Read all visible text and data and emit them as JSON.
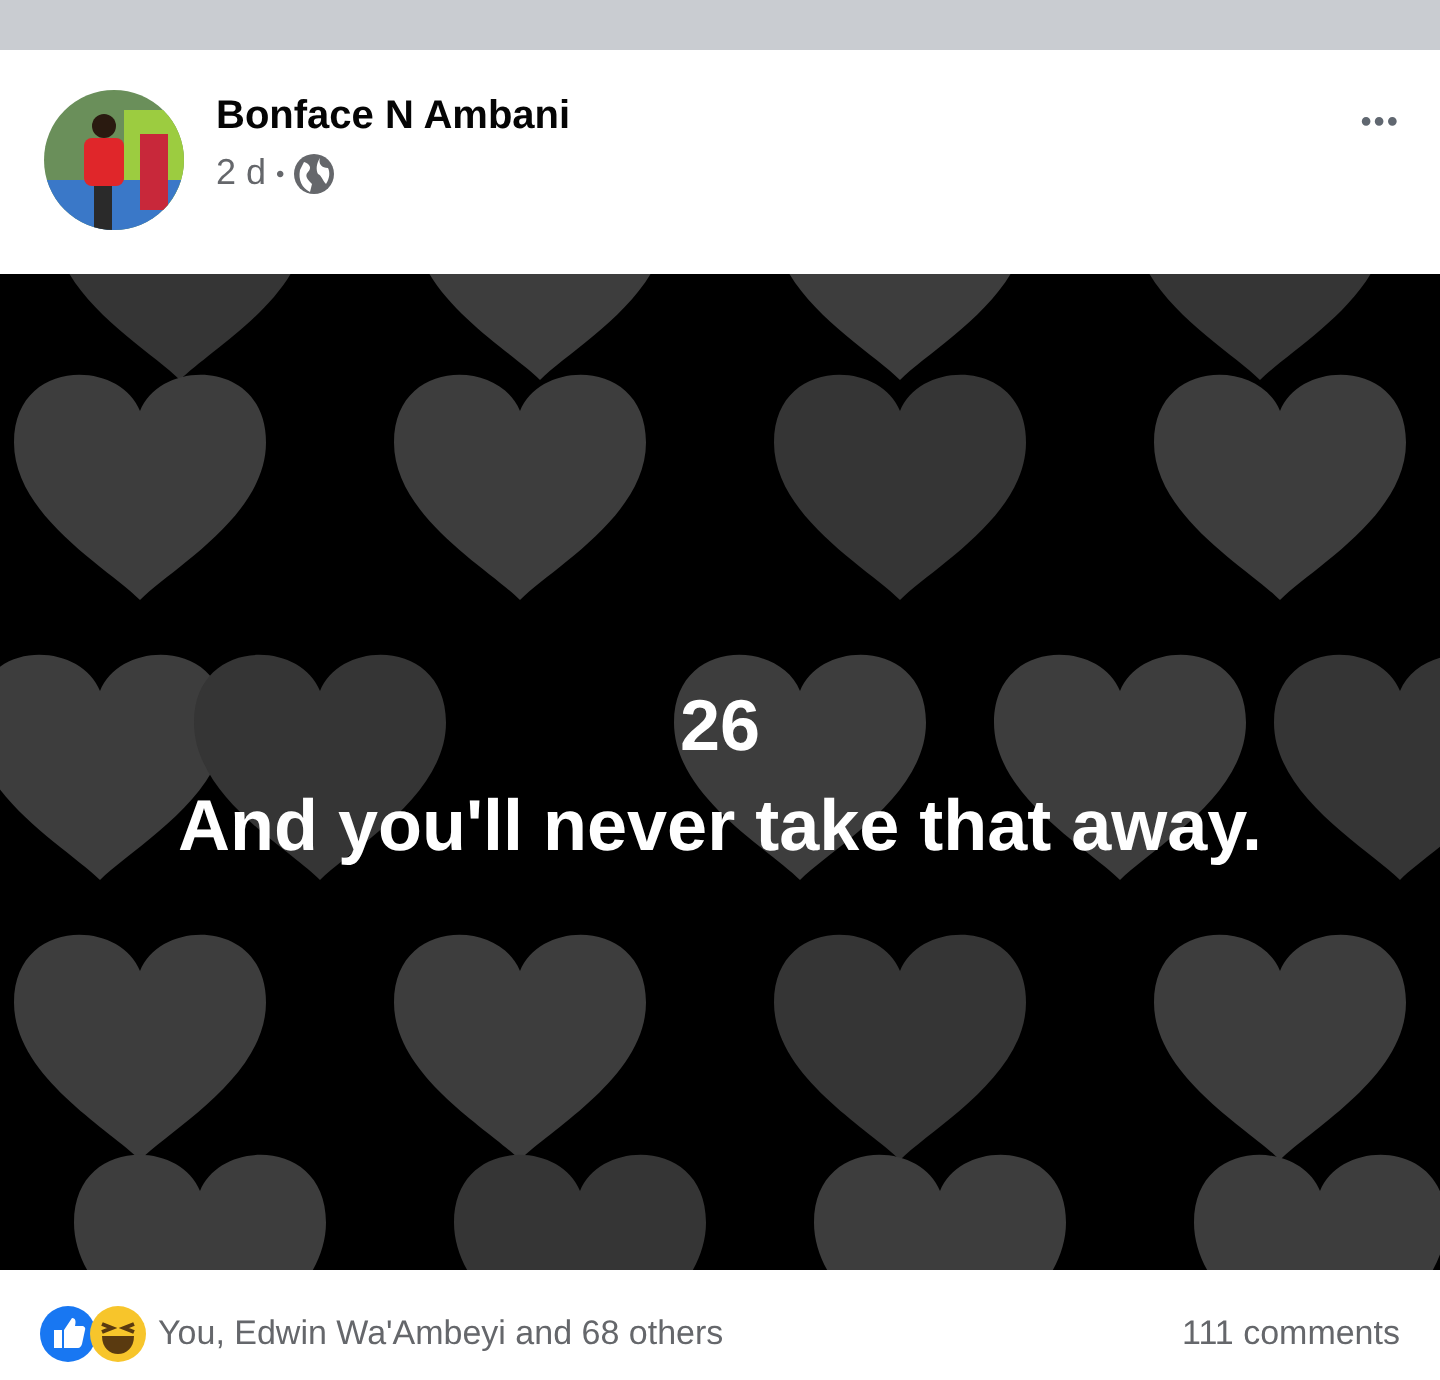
{
  "post": {
    "author": "Bonface N Ambani",
    "time": "2 d",
    "separator": "•",
    "more": "•••"
  },
  "image_text": {
    "number": "26",
    "line": "And you'll never take that away."
  },
  "footer": {
    "reactions": "You, Edwin Wa'Ambeyi and 68 others",
    "comments": "111 comments"
  }
}
